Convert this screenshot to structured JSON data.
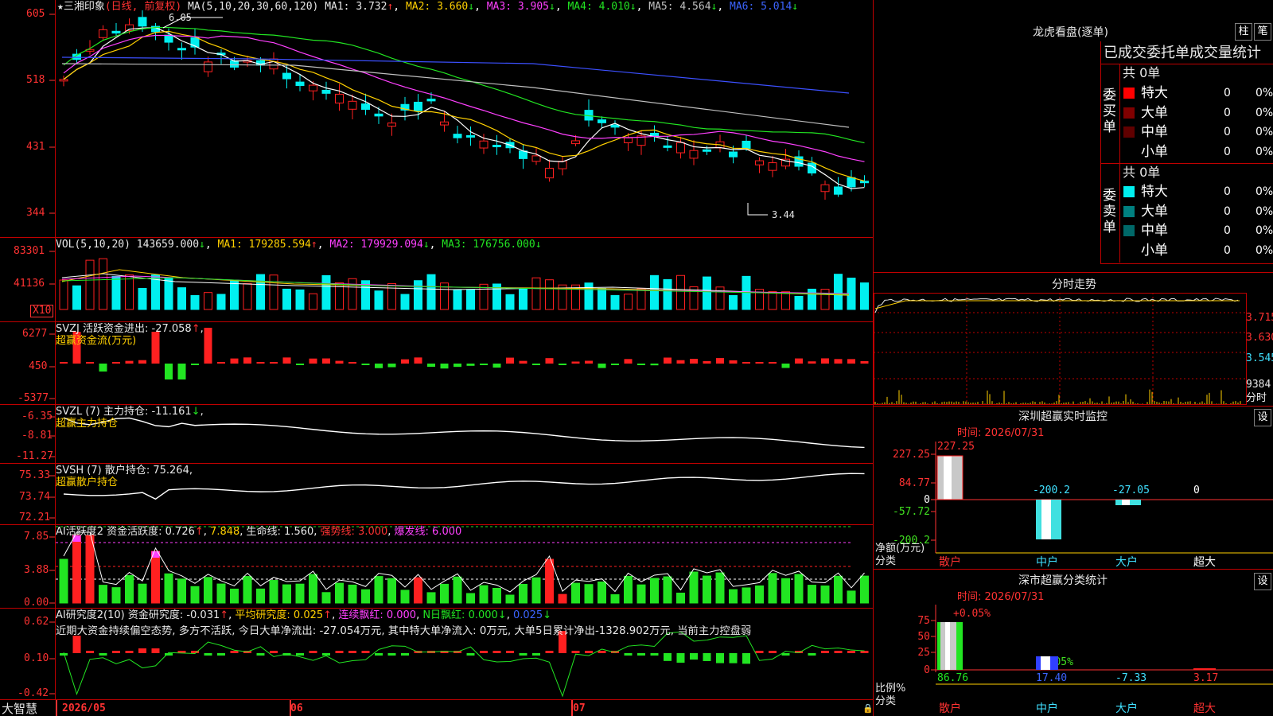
{
  "app": {
    "brand": "大智慧"
  },
  "main_chart": {
    "stock_name": "三湘印象",
    "period_label": "(日线, 前复权)",
    "ma_prefix": "MA(5,10,20,30,60,120)",
    "ma1": "MA1: 3.732",
    "ma2": "MA2: 3.660",
    "ma3": "MA3: 3.905",
    "ma4": "MA4: 4.010",
    "ma5": "MA5: 4.564",
    "ma6": "MA6: 5.014",
    "y_ticks": [
      "605",
      "518",
      "431",
      "344"
    ],
    "high_mark": "6.05",
    "low_mark": "3.44",
    "colors": {
      "up": "#ff2020",
      "down": "#00f0f0",
      "ma5": "#ffffff",
      "ma10": "#ffd000",
      "ma20": "#ff40ff",
      "ma30": "#22e522",
      "ma60": "#c0c0c0",
      "ma120": "#3c50ff"
    }
  },
  "volume": {
    "header_prefix": "VOL(5,10,20)",
    "value": "143659.000",
    "ma1": "MA1: 179285.594",
    "ma2": "MA2: 179929.094",
    "ma3": "MA3: 176756.000",
    "y_ticks": [
      "83301",
      "41136"
    ],
    "unit": "X10"
  },
  "svzj": {
    "header": "SVZJ  活跃资金进出: -27.058",
    "sub": "超赢资金流(万元)",
    "y_ticks": [
      "6277",
      "450",
      "-5377"
    ]
  },
  "svzl": {
    "header": "SVZL (7) 主力持仓: -11.161",
    "sub": "超赢主力持仓",
    "y_ticks": [
      "-6.35",
      "-8.81",
      "-11.27"
    ]
  },
  "svsh": {
    "header": "SVSH (7) 散户持仓: 75.264",
    "sub": "超赢散户持仓",
    "y_ticks": [
      "75.33",
      "73.74",
      "72.21"
    ]
  },
  "ai_active": {
    "name": "AI活跃度2",
    "capital": "资金活跃度: 0.726",
    "val2": "7.848",
    "life": "生命线: 1.560",
    "strong": "强势线: 3.000",
    "burst": "爆发线: 6.000",
    "y_ticks": [
      "7.85",
      "3.88",
      "0.00"
    ]
  },
  "ai_research": {
    "name": "AI研究度2(10)",
    "capital": "资金研究度: -0.031",
    "avg": "平均研究度: 0.025",
    "cont": "连续飘红: 0.000",
    "nday": "N日飘红: 0.000",
    "val": "0.025",
    "summary": "近期大资金持续偏空态势, 多方不活跃, 今日大单净流出: -27.054万元, 其中特大单净流入: 0万元, 大单5日累计净出-1328.902万元, 当前主力控盘弱",
    "y_ticks": [
      "0.62",
      "0.10",
      "-0.42"
    ]
  },
  "x_axis": {
    "labels": [
      "2026/05",
      "06",
      "07"
    ]
  },
  "right_panel": {
    "longhu_title": "龙虎看盘(逐单)",
    "btn_bar": "柱",
    "btn_pen": "笔",
    "order_title": "已成交委托单成交量统计",
    "buy_label": [
      "委",
      "买",
      "单"
    ],
    "sell_label": [
      "委",
      "卖",
      "单"
    ],
    "buy_total": "共 0单",
    "sell_total": "共 0单",
    "buy_rows": [
      {
        "name": "特大",
        "count": "0",
        "pct": "0%",
        "color": "#ff0000"
      },
      {
        "name": "大单",
        "count": "0",
        "pct": "0%",
        "color": "#800000"
      },
      {
        "name": "中单",
        "count": "0",
        "pct": "0%",
        "color": "#600000"
      },
      {
        "name": "小单",
        "count": "0",
        "pct": "0%",
        "color": ""
      }
    ],
    "sell_rows": [
      {
        "name": "特大",
        "count": "0",
        "pct": "0%",
        "color": "#00f0f0"
      },
      {
        "name": "大单",
        "count": "0",
        "pct": "0%",
        "color": "#008080"
      },
      {
        "name": "中单",
        "count": "0",
        "pct": "0%",
        "color": "#006868"
      },
      {
        "name": "小单",
        "count": "0",
        "pct": "0%",
        "color": ""
      }
    ],
    "intraday_title": "分时走势",
    "intraday_ticks": [
      "3.715",
      "3.630",
      "3.545",
      "9384",
      "分时"
    ],
    "sz_title": "深圳超赢实时监控",
    "sz_time": "时间: 2026/07/31",
    "sz_y_ticks": [
      "227.25",
      "84.77",
      "0",
      "-57.72",
      "-200.2"
    ],
    "sz_values": [
      "227.25",
      "-200.2",
      "-27.05",
      "0"
    ],
    "sz_y_label": "净额(万元)",
    "sz_cat_label": "分类",
    "sz_categories": [
      "散户",
      "中户",
      "大户",
      "超大"
    ],
    "set_btn": "设",
    "sh_title": "深市超赢分类统计",
    "sh_time": "时间: 2026/07/31",
    "sh_top_labels": [
      "+0.05%",
      "-0.05%"
    ],
    "sh_y_ticks": [
      "75",
      "50",
      "25",
      "0"
    ],
    "sh_values": [
      "86.76",
      "17.40",
      "-7.33",
      "3.17"
    ],
    "sh_y_label": "比例%",
    "sh_cat_label": "分类",
    "sh_categories": [
      "散户",
      "中户",
      "大户",
      "超大"
    ]
  }
}
